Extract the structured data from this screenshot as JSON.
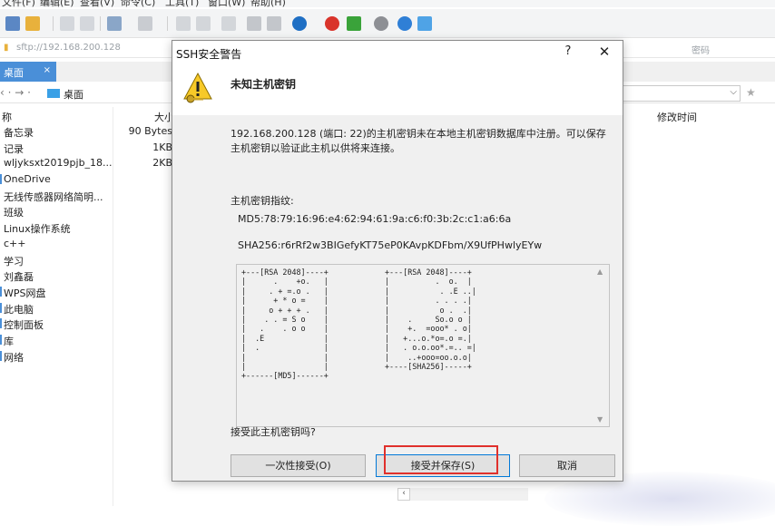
{
  "background": {
    "menubar_items": [
      "文件(F)",
      "编辑(E)",
      "查看(V)",
      "命令(C)",
      "工具(T)",
      "窗口(W)",
      "帮助(H)"
    ],
    "address": "sftp://192.168.200.128",
    "password_placeholder": "密码",
    "tab_label": "桌面",
    "tab_close": "×",
    "nav_back": "‹ · → ·",
    "nav_path": "桌面",
    "list_header": {
      "name": "称",
      "size": "大小",
      "mtime": "修改时间"
    },
    "files": [
      {
        "name": "备忘录",
        "size": "90 Bytes",
        "marker": false
      },
      {
        "name": "记录",
        "size": "1KB",
        "marker": false
      },
      {
        "name": "wljyksxt2019pjb_18...",
        "size": "2KB",
        "marker": false
      },
      {
        "name": "OneDrive",
        "size": "",
        "marker": true
      },
      {
        "name": "无线传感器网络简明...",
        "size": "",
        "marker": false
      },
      {
        "name": "班级",
        "size": "",
        "marker": false
      },
      {
        "name": "Linux操作系统",
        "size": "",
        "marker": false
      },
      {
        "name": "c++",
        "size": "",
        "marker": false
      },
      {
        "name": "学习",
        "size": "",
        "marker": false
      },
      {
        "name": "刘鑫磊",
        "size": "",
        "marker": false
      },
      {
        "name": "WPS网盘",
        "size": "",
        "marker": true
      },
      {
        "name": "此电脑",
        "size": "",
        "marker": true
      },
      {
        "name": "控制面板",
        "size": "",
        "marker": true
      },
      {
        "name": "库",
        "size": "",
        "marker": true
      },
      {
        "name": "网络",
        "size": "",
        "marker": true
      }
    ]
  },
  "dialog": {
    "title": "SSH安全警告",
    "help": "?",
    "close": "✕",
    "heading": "未知主机密钥",
    "message": "192.168.200.128 (端口: 22)的主机密钥未在本地主机密钥数据库中注册。可以保存主机密钥以验证此主机以供将来连接。",
    "fingerprint_label": "主机密钥指纹:",
    "md5": "MD5:78:79:16:96:e4:62:94:61:9a:c6:f0:3b:2c:c1:a6:6a",
    "sha256": "SHA256:r6rRf2w3BIGefyKT75eP0KAvpKDFbm/X9UfPHwlyEYw",
    "randomart_md5": "+---[RSA 2048]----+\n|      .    +o.   |\n|     . + =.o .   |\n|      + * o =    |\n|     o + + + .   |\n|    . . = S o    |\n|   .    . o o    |\n|  .E             |\n|  .              |\n|                 |\n|                 |\n+------[MD5]------+",
    "randomart_sha256": "+---[RSA 2048]----+\n|          .  o.  |\n|           . .E ..|\n|          . . . .|\n|           o .  .|\n|    .     So.o o |\n|    +.  =ooo* . o|\n|   +...o.*o=.o =.|\n|   . o.o.oo*.=.. =|\n|    ..+ooo=oo.o.o|\n+----[SHA256]-----+",
    "question": "接受此主机密钥吗?",
    "buttons": {
      "once": "一次性接受(O)",
      "accept_save": "接受并保存(S)",
      "cancel": "取消"
    },
    "colors": {
      "highlight": "#e0302c",
      "focus_border": "#0078d7"
    }
  }
}
